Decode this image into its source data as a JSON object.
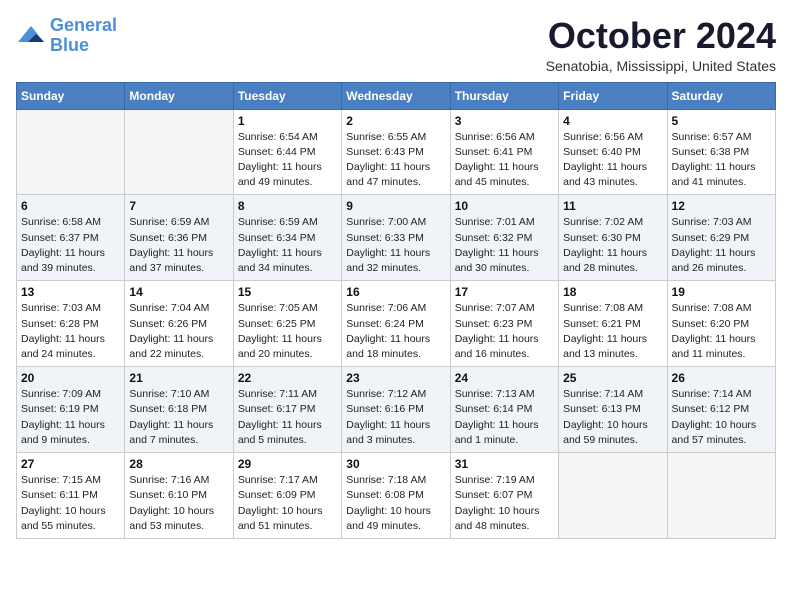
{
  "logo": {
    "text_general": "General",
    "text_blue": "Blue"
  },
  "header": {
    "month": "October 2024",
    "location": "Senatobia, Mississippi, United States"
  },
  "weekdays": [
    "Sunday",
    "Monday",
    "Tuesday",
    "Wednesday",
    "Thursday",
    "Friday",
    "Saturday"
  ],
  "weeks": [
    [
      {
        "day": "",
        "info": ""
      },
      {
        "day": "",
        "info": ""
      },
      {
        "day": "1",
        "info": "Sunrise: 6:54 AM\nSunset: 6:44 PM\nDaylight: 11 hours and 49 minutes."
      },
      {
        "day": "2",
        "info": "Sunrise: 6:55 AM\nSunset: 6:43 PM\nDaylight: 11 hours and 47 minutes."
      },
      {
        "day": "3",
        "info": "Sunrise: 6:56 AM\nSunset: 6:41 PM\nDaylight: 11 hours and 45 minutes."
      },
      {
        "day": "4",
        "info": "Sunrise: 6:56 AM\nSunset: 6:40 PM\nDaylight: 11 hours and 43 minutes."
      },
      {
        "day": "5",
        "info": "Sunrise: 6:57 AM\nSunset: 6:38 PM\nDaylight: 11 hours and 41 minutes."
      }
    ],
    [
      {
        "day": "6",
        "info": "Sunrise: 6:58 AM\nSunset: 6:37 PM\nDaylight: 11 hours and 39 minutes."
      },
      {
        "day": "7",
        "info": "Sunrise: 6:59 AM\nSunset: 6:36 PM\nDaylight: 11 hours and 37 minutes."
      },
      {
        "day": "8",
        "info": "Sunrise: 6:59 AM\nSunset: 6:34 PM\nDaylight: 11 hours and 34 minutes."
      },
      {
        "day": "9",
        "info": "Sunrise: 7:00 AM\nSunset: 6:33 PM\nDaylight: 11 hours and 32 minutes."
      },
      {
        "day": "10",
        "info": "Sunrise: 7:01 AM\nSunset: 6:32 PM\nDaylight: 11 hours and 30 minutes."
      },
      {
        "day": "11",
        "info": "Sunrise: 7:02 AM\nSunset: 6:30 PM\nDaylight: 11 hours and 28 minutes."
      },
      {
        "day": "12",
        "info": "Sunrise: 7:03 AM\nSunset: 6:29 PM\nDaylight: 11 hours and 26 minutes."
      }
    ],
    [
      {
        "day": "13",
        "info": "Sunrise: 7:03 AM\nSunset: 6:28 PM\nDaylight: 11 hours and 24 minutes."
      },
      {
        "day": "14",
        "info": "Sunrise: 7:04 AM\nSunset: 6:26 PM\nDaylight: 11 hours and 22 minutes."
      },
      {
        "day": "15",
        "info": "Sunrise: 7:05 AM\nSunset: 6:25 PM\nDaylight: 11 hours and 20 minutes."
      },
      {
        "day": "16",
        "info": "Sunrise: 7:06 AM\nSunset: 6:24 PM\nDaylight: 11 hours and 18 minutes."
      },
      {
        "day": "17",
        "info": "Sunrise: 7:07 AM\nSunset: 6:23 PM\nDaylight: 11 hours and 16 minutes."
      },
      {
        "day": "18",
        "info": "Sunrise: 7:08 AM\nSunset: 6:21 PM\nDaylight: 11 hours and 13 minutes."
      },
      {
        "day": "19",
        "info": "Sunrise: 7:08 AM\nSunset: 6:20 PM\nDaylight: 11 hours and 11 minutes."
      }
    ],
    [
      {
        "day": "20",
        "info": "Sunrise: 7:09 AM\nSunset: 6:19 PM\nDaylight: 11 hours and 9 minutes."
      },
      {
        "day": "21",
        "info": "Sunrise: 7:10 AM\nSunset: 6:18 PM\nDaylight: 11 hours and 7 minutes."
      },
      {
        "day": "22",
        "info": "Sunrise: 7:11 AM\nSunset: 6:17 PM\nDaylight: 11 hours and 5 minutes."
      },
      {
        "day": "23",
        "info": "Sunrise: 7:12 AM\nSunset: 6:16 PM\nDaylight: 11 hours and 3 minutes."
      },
      {
        "day": "24",
        "info": "Sunrise: 7:13 AM\nSunset: 6:14 PM\nDaylight: 11 hours and 1 minute."
      },
      {
        "day": "25",
        "info": "Sunrise: 7:14 AM\nSunset: 6:13 PM\nDaylight: 10 hours and 59 minutes."
      },
      {
        "day": "26",
        "info": "Sunrise: 7:14 AM\nSunset: 6:12 PM\nDaylight: 10 hours and 57 minutes."
      }
    ],
    [
      {
        "day": "27",
        "info": "Sunrise: 7:15 AM\nSunset: 6:11 PM\nDaylight: 10 hours and 55 minutes."
      },
      {
        "day": "28",
        "info": "Sunrise: 7:16 AM\nSunset: 6:10 PM\nDaylight: 10 hours and 53 minutes."
      },
      {
        "day": "29",
        "info": "Sunrise: 7:17 AM\nSunset: 6:09 PM\nDaylight: 10 hours and 51 minutes."
      },
      {
        "day": "30",
        "info": "Sunrise: 7:18 AM\nSunset: 6:08 PM\nDaylight: 10 hours and 49 minutes."
      },
      {
        "day": "31",
        "info": "Sunrise: 7:19 AM\nSunset: 6:07 PM\nDaylight: 10 hours and 48 minutes."
      },
      {
        "day": "",
        "info": ""
      },
      {
        "day": "",
        "info": ""
      }
    ]
  ]
}
